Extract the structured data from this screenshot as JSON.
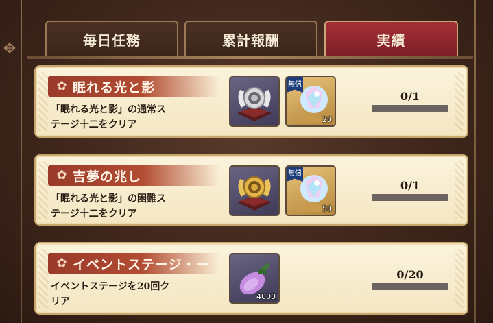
{
  "tabs": [
    {
      "label": "毎日任務",
      "active": false
    },
    {
      "label": "累計報酬",
      "active": false
    },
    {
      "label": "実績",
      "active": true
    }
  ],
  "missions": [
    {
      "title": "眠れる光と影",
      "description_line1": "「眠れる光と影」の通常ス",
      "description_line2": "テージ十二をクリア",
      "rewards": [
        {
          "icon": "silver-crest-icon",
          "count": ""
        },
        {
          "icon": "crystal-gem-icon",
          "tag": "無償",
          "count": "20"
        }
      ],
      "progress_text": "0/1",
      "progress": 0
    },
    {
      "title": "吉夢の兆し",
      "description_line1": "「眠れる光と影」の困難ス",
      "description_line2": "テージ十二をクリア",
      "rewards": [
        {
          "icon": "gold-crest-icon",
          "count": ""
        },
        {
          "icon": "crystal-gem-icon",
          "tag": "無償",
          "count": "50"
        }
      ],
      "progress_text": "0/1",
      "progress": 0
    },
    {
      "title": "イベントステージ・ー",
      "description_line1": "イベントステージを20回ク",
      "description_line2": "リア",
      "rewards": [
        {
          "icon": "eggplant-icon",
          "count": "4000"
        }
      ],
      "progress_text": "0/20",
      "progress": 0
    }
  ]
}
